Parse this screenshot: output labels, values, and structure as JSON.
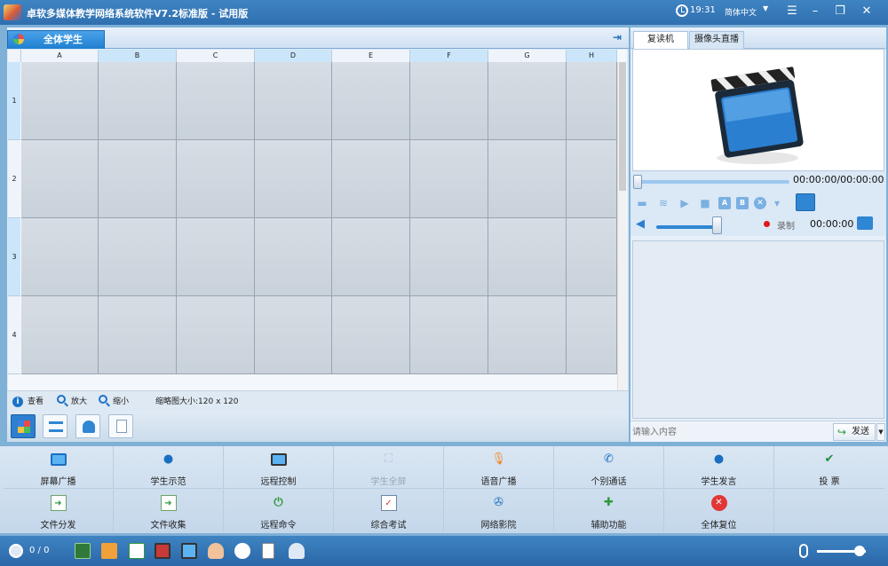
{
  "titlebar": {
    "title": "卓软多媒体教学网络系统软件V7.2标准版 - 试用版",
    "time": "19:31",
    "language": "简体中文",
    "lang_arrow": "▼"
  },
  "left": {
    "tab": "全体学生",
    "columns": [
      "A",
      "B",
      "C",
      "D",
      "E",
      "F",
      "G",
      "H"
    ],
    "rows": [
      "1",
      "2",
      "3",
      "4"
    ],
    "view_toolbar": {
      "view": "查看",
      "zoom_in": "放大",
      "zoom_out": "缩小",
      "thumb_size": "缩略图大小:120 x 120"
    }
  },
  "right": {
    "tabs": [
      "复读机",
      "摄像头直播"
    ],
    "time": "00:00:00/00:00:00",
    "record_label": "录制",
    "record_time": "00:00:00",
    "chat_placeholder": "请输入内容",
    "send": "发送",
    "send_drop": "▼"
  },
  "functions": {
    "row1": [
      "屏幕广播",
      "学生示范",
      "远程控制",
      "学生全屏",
      "语音广播",
      "个别通话",
      "学生发言",
      "投 票"
    ],
    "row2": [
      "文件分发",
      "文件收集",
      "远程命令",
      "综合考试",
      "网络影院",
      "辅助功能",
      "全体复位"
    ]
  },
  "statusbar": {
    "count": "0 / 0"
  },
  "colors": {
    "title_bg": "#2f6fb0",
    "accent": "#2f86d3",
    "record": "#e01818",
    "panel": "#dce9f6"
  }
}
